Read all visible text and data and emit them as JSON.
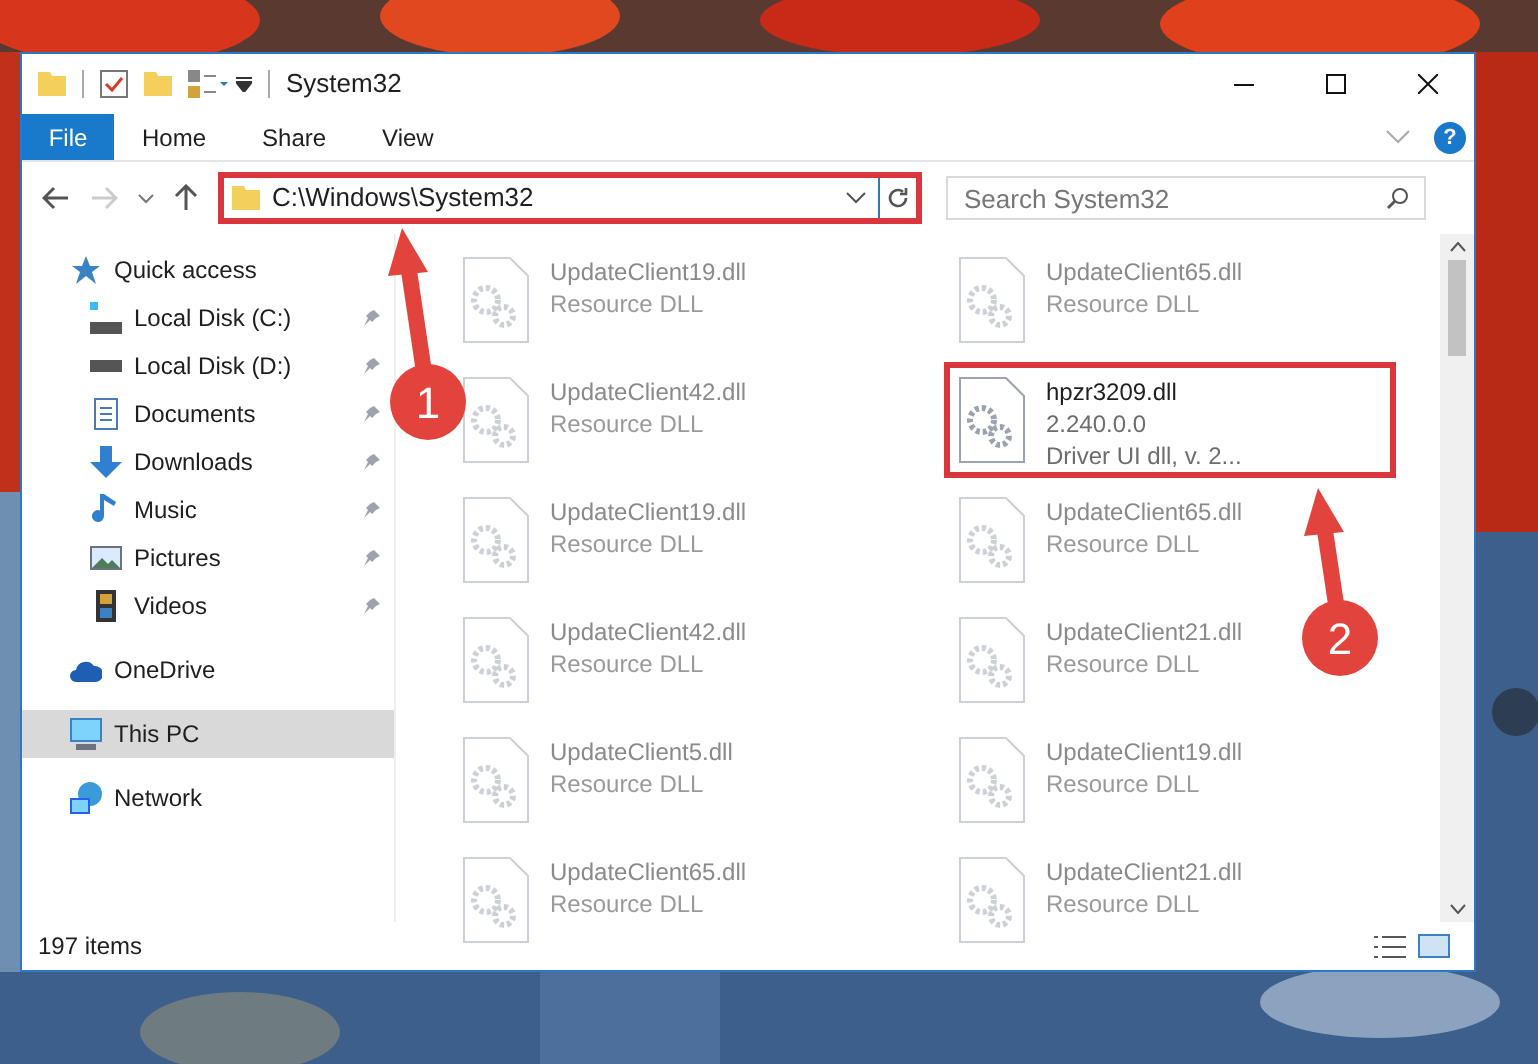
{
  "window": {
    "title": "System32"
  },
  "ribbon_tabs": [
    {
      "label": "File",
      "kind": "file_menu"
    },
    {
      "label": "Home",
      "kind": "tab"
    },
    {
      "label": "Share",
      "kind": "tab"
    },
    {
      "label": "View",
      "kind": "tab"
    }
  ],
  "help": "?",
  "address_bar": {
    "path": "C:\\Windows\\System32",
    "highlighted": true
  },
  "search": {
    "placeholder": "Search System32"
  },
  "sidebar": {
    "items": [
      {
        "label": "Quick access",
        "kind": "star",
        "selected": false,
        "children": [
          {
            "label": "Local Disk (C:)",
            "kind": "drive_c",
            "pinned": true
          },
          {
            "label": "Local Disk (D:)",
            "kind": "drive",
            "pinned": true
          },
          {
            "label": "Documents",
            "kind": "documents",
            "pinned": true
          },
          {
            "label": "Downloads",
            "kind": "downloads",
            "pinned": true
          },
          {
            "label": "Music",
            "kind": "music",
            "pinned": true
          },
          {
            "label": "Pictures",
            "kind": "pictures",
            "pinned": true
          },
          {
            "label": "Videos",
            "kind": "videos",
            "pinned": true
          }
        ]
      },
      {
        "label": "OneDrive",
        "kind": "cloud",
        "selected": false
      },
      {
        "label": "This PC",
        "kind": "pc",
        "selected": true
      },
      {
        "label": "Network",
        "kind": "network",
        "selected": false
      }
    ]
  },
  "files": [
    {
      "name": "UpdateClient19.dll",
      "details": [
        "Resource DLL"
      ],
      "blurred": true,
      "highlighted": false
    },
    {
      "name": "UpdateClient65.dll",
      "details": [
        "Resource DLL"
      ],
      "blurred": true,
      "highlighted": false
    },
    {
      "name": "UpdateClient42.dll",
      "details": [
        "Resource DLL"
      ],
      "blurred": true,
      "highlighted": false
    },
    {
      "name": "hpzr3209.dll",
      "details": [
        "2.240.0.0",
        "Driver UI dll, v. 2..."
      ],
      "blurred": false,
      "highlighted": true
    },
    {
      "name": "UpdateClient19.dll",
      "details": [
        "Resource DLL"
      ],
      "blurred": true,
      "highlighted": false
    },
    {
      "name": "UpdateClient65.dll",
      "details": [
        "Resource DLL"
      ],
      "blurred": true,
      "highlighted": false
    },
    {
      "name": "UpdateClient42.dll",
      "details": [
        "Resource DLL"
      ],
      "blurred": true,
      "highlighted": false
    },
    {
      "name": "UpdateClient21.dll",
      "details": [
        "Resource DLL"
      ],
      "blurred": true,
      "highlighted": false
    },
    {
      "name": "UpdateClient5.dll",
      "details": [
        "Resource DLL"
      ],
      "blurred": true,
      "highlighted": false
    },
    {
      "name": "UpdateClient19.dll",
      "details": [
        "Resource DLL"
      ],
      "blurred": true,
      "highlighted": false
    },
    {
      "name": "UpdateClient65.dll",
      "details": [
        "Resource DLL"
      ],
      "blurred": true,
      "highlighted": false
    },
    {
      "name": "UpdateClient21.dll",
      "details": [
        "Resource DLL"
      ],
      "blurred": true,
      "highlighted": false
    }
  ],
  "status_bar": {
    "item_count": "197 items"
  },
  "annotations": [
    {
      "label": "1"
    },
    {
      "label": "2"
    }
  ]
}
